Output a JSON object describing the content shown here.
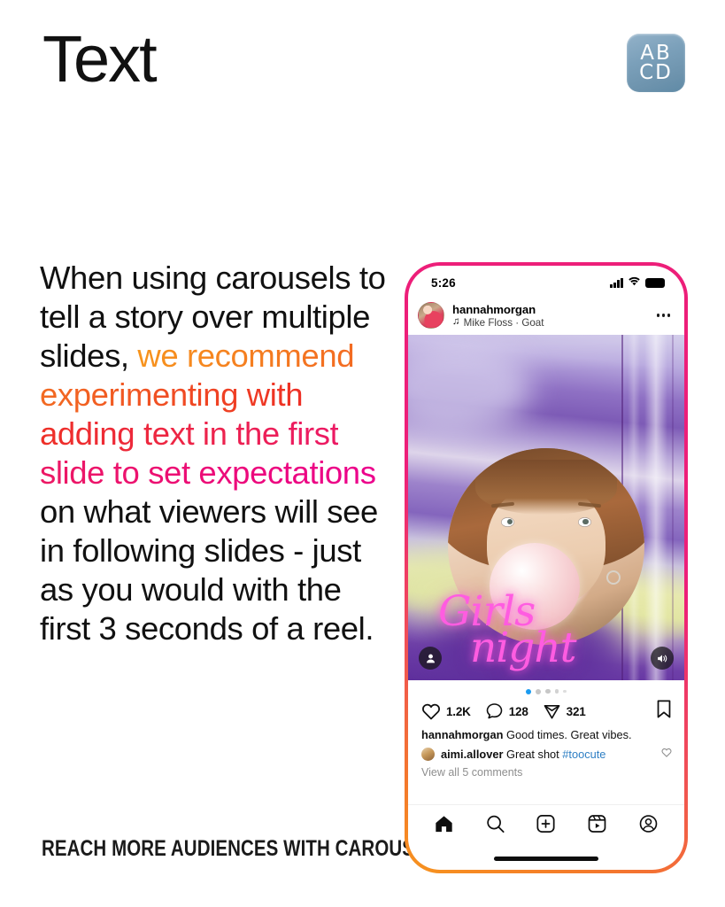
{
  "header": {
    "title": "Text",
    "emoji_badge": {
      "name": "abcd-input-symbol",
      "line1": "AB",
      "line2": "CD",
      "color": "#7ba0ba"
    }
  },
  "body": {
    "segments": [
      {
        "text": "When using carousels to tell a story over multiple slides, ",
        "style": "plain"
      },
      {
        "text": "we recommend experimenting with adding text in the first slide to set expectations ",
        "style": "gradient"
      },
      {
        "text": "on what viewers will see in following slides - just as you would with the first 3 seconds of a reel.",
        "style": "plain"
      }
    ],
    "full_text": "When using carousels to tell a story over multiple slides, we recommend experimenting with adding text in the first slide to set expectations on what viewers will see in following slides - just as you would with the first 3 seconds of a reel.",
    "gradient_from": "#F7941E",
    "gradient_to": "#EC008C"
  },
  "kicker": "REACH MORE AUDIENCES WITH CAROUSELS",
  "phone": {
    "frame_gradient_from": "#ED1E79",
    "frame_gradient_to": "#F7941E",
    "status_bar": {
      "time": "5:26",
      "icons": [
        "signal-bars-icon",
        "wifi-icon",
        "battery-icon"
      ]
    },
    "post_header": {
      "username": "hannahmorgan",
      "audio": "Mike Floss · Goat",
      "audio_icon": "music-note-icon",
      "menu_icon": "more-options-icon"
    },
    "photo": {
      "overlay_caption_line1": "Girls",
      "overlay_caption_line2": "night",
      "overlay_caption_color": "#FF5CE1",
      "tag_icon": "person-tag-icon",
      "audio_icon": "speaker-on-icon",
      "alt": "woman blowing a bubblegum bubble in a circular crop over a purple and yellow abstract background"
    },
    "carousel": {
      "total_dots": 5,
      "active_index": 0,
      "active_color": "#1a9bf0"
    },
    "actions": [
      {
        "name": "like",
        "icon": "heart-icon",
        "count": "1.2K"
      },
      {
        "name": "comment",
        "icon": "comment-bubble-icon",
        "count": "128"
      },
      {
        "name": "share",
        "icon": "paper-plane-icon",
        "count": "321"
      }
    ],
    "save_icon": "bookmark-icon",
    "captions": {
      "owner_user": "hannahmorgan",
      "owner_text": "Good times. Great vibes.",
      "comment_user": "aimi.allover",
      "comment_text": "Great shot ",
      "comment_hashtag": "#toocute",
      "comment_like_icon": "heart-outline-icon",
      "view_all": "View all 5 comments"
    },
    "nav": [
      {
        "name": "home",
        "icon": "home-icon"
      },
      {
        "name": "search",
        "icon": "search-icon"
      },
      {
        "name": "create",
        "icon": "plus-square-icon"
      },
      {
        "name": "reels",
        "icon": "reels-icon"
      },
      {
        "name": "profile",
        "icon": "profile-circle-icon"
      }
    ]
  }
}
